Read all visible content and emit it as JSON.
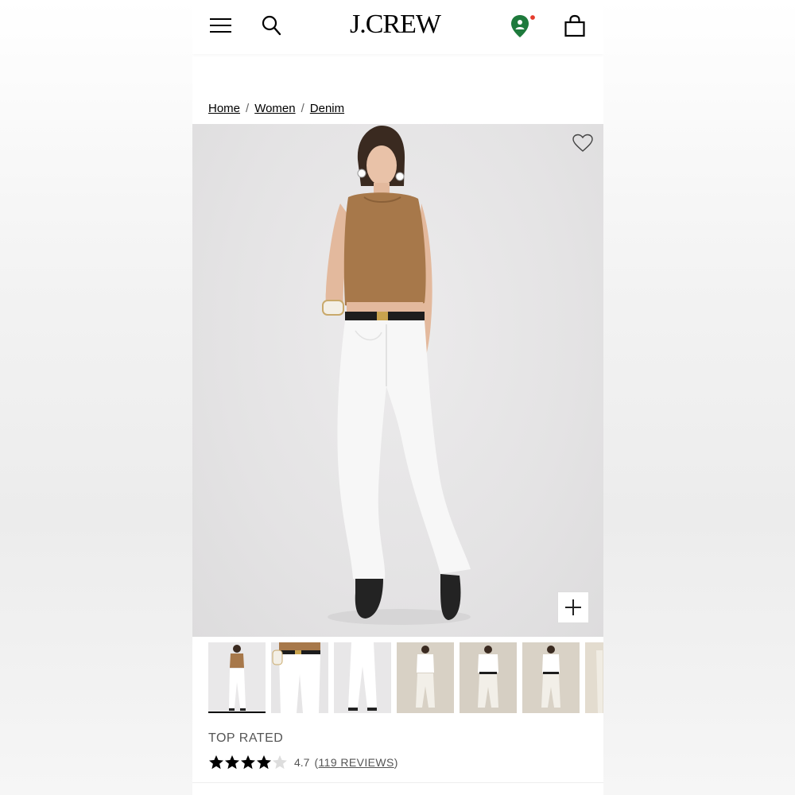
{
  "header": {
    "logo": "J.CREW",
    "icons": [
      "menu-icon",
      "search-icon",
      "location-pin-icon",
      "shopping-bag-icon"
    ],
    "notification_dot_color": "#e53b2c",
    "location_icon_color": "#1e7a3c"
  },
  "breadcrumb": {
    "items": [
      "Home",
      "Women",
      "Denim"
    ],
    "separator": "/"
  },
  "product": {
    "hero_image": "model wearing tan sleeveless knit top and white flare jeans",
    "colors": {
      "top": "#a7784a",
      "jeans": "#f7f7f7",
      "background": "#e6e5e6"
    }
  },
  "thumbnails": {
    "count_visible": 7,
    "active_index": 0
  },
  "rating": {
    "badge": "TOP RATED",
    "value": "4.7",
    "reviews_prefix": "(",
    "reviews_label": "119 REVIEWS",
    "reviews_suffix": ")",
    "stars": 4.7
  }
}
